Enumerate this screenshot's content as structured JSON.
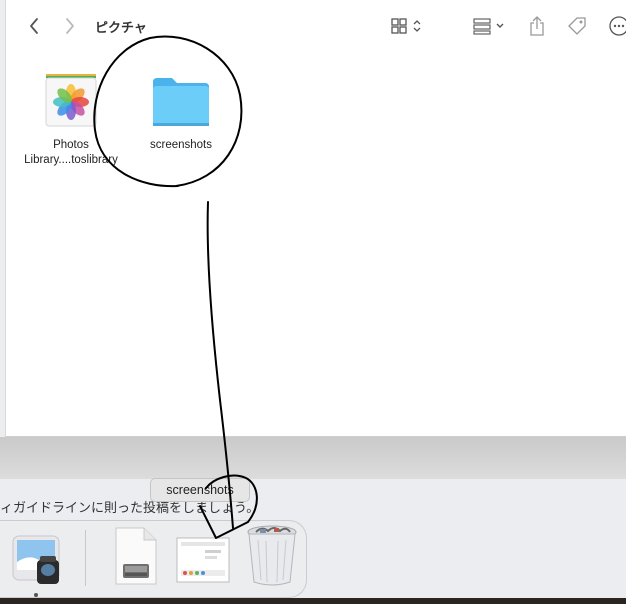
{
  "finder": {
    "title": "ピクチャ",
    "items": [
      {
        "label_line1": "Photos",
        "label_line2": "Library....toslibrary",
        "icon": "photos-library-icon"
      },
      {
        "label": "screenshots",
        "icon": "folder-icon"
      }
    ],
    "toolbar_icons": [
      "back-icon",
      "forward-icon",
      "icon-view-icon",
      "group-icon",
      "share-icon",
      "tag-icon",
      "more-icon"
    ]
  },
  "background_window": {
    "text": "ィガイドラインに則った投稿をしましょう。"
  },
  "dock": {
    "tooltip": "screenshots",
    "items": [
      "preview-app-icon",
      "disk-image-icon",
      "screenshots-stack-icon",
      "trash-icon"
    ]
  },
  "colors": {
    "folder": "#5ac2f5",
    "annotation": "#000000",
    "accent": "#0a84ff"
  }
}
